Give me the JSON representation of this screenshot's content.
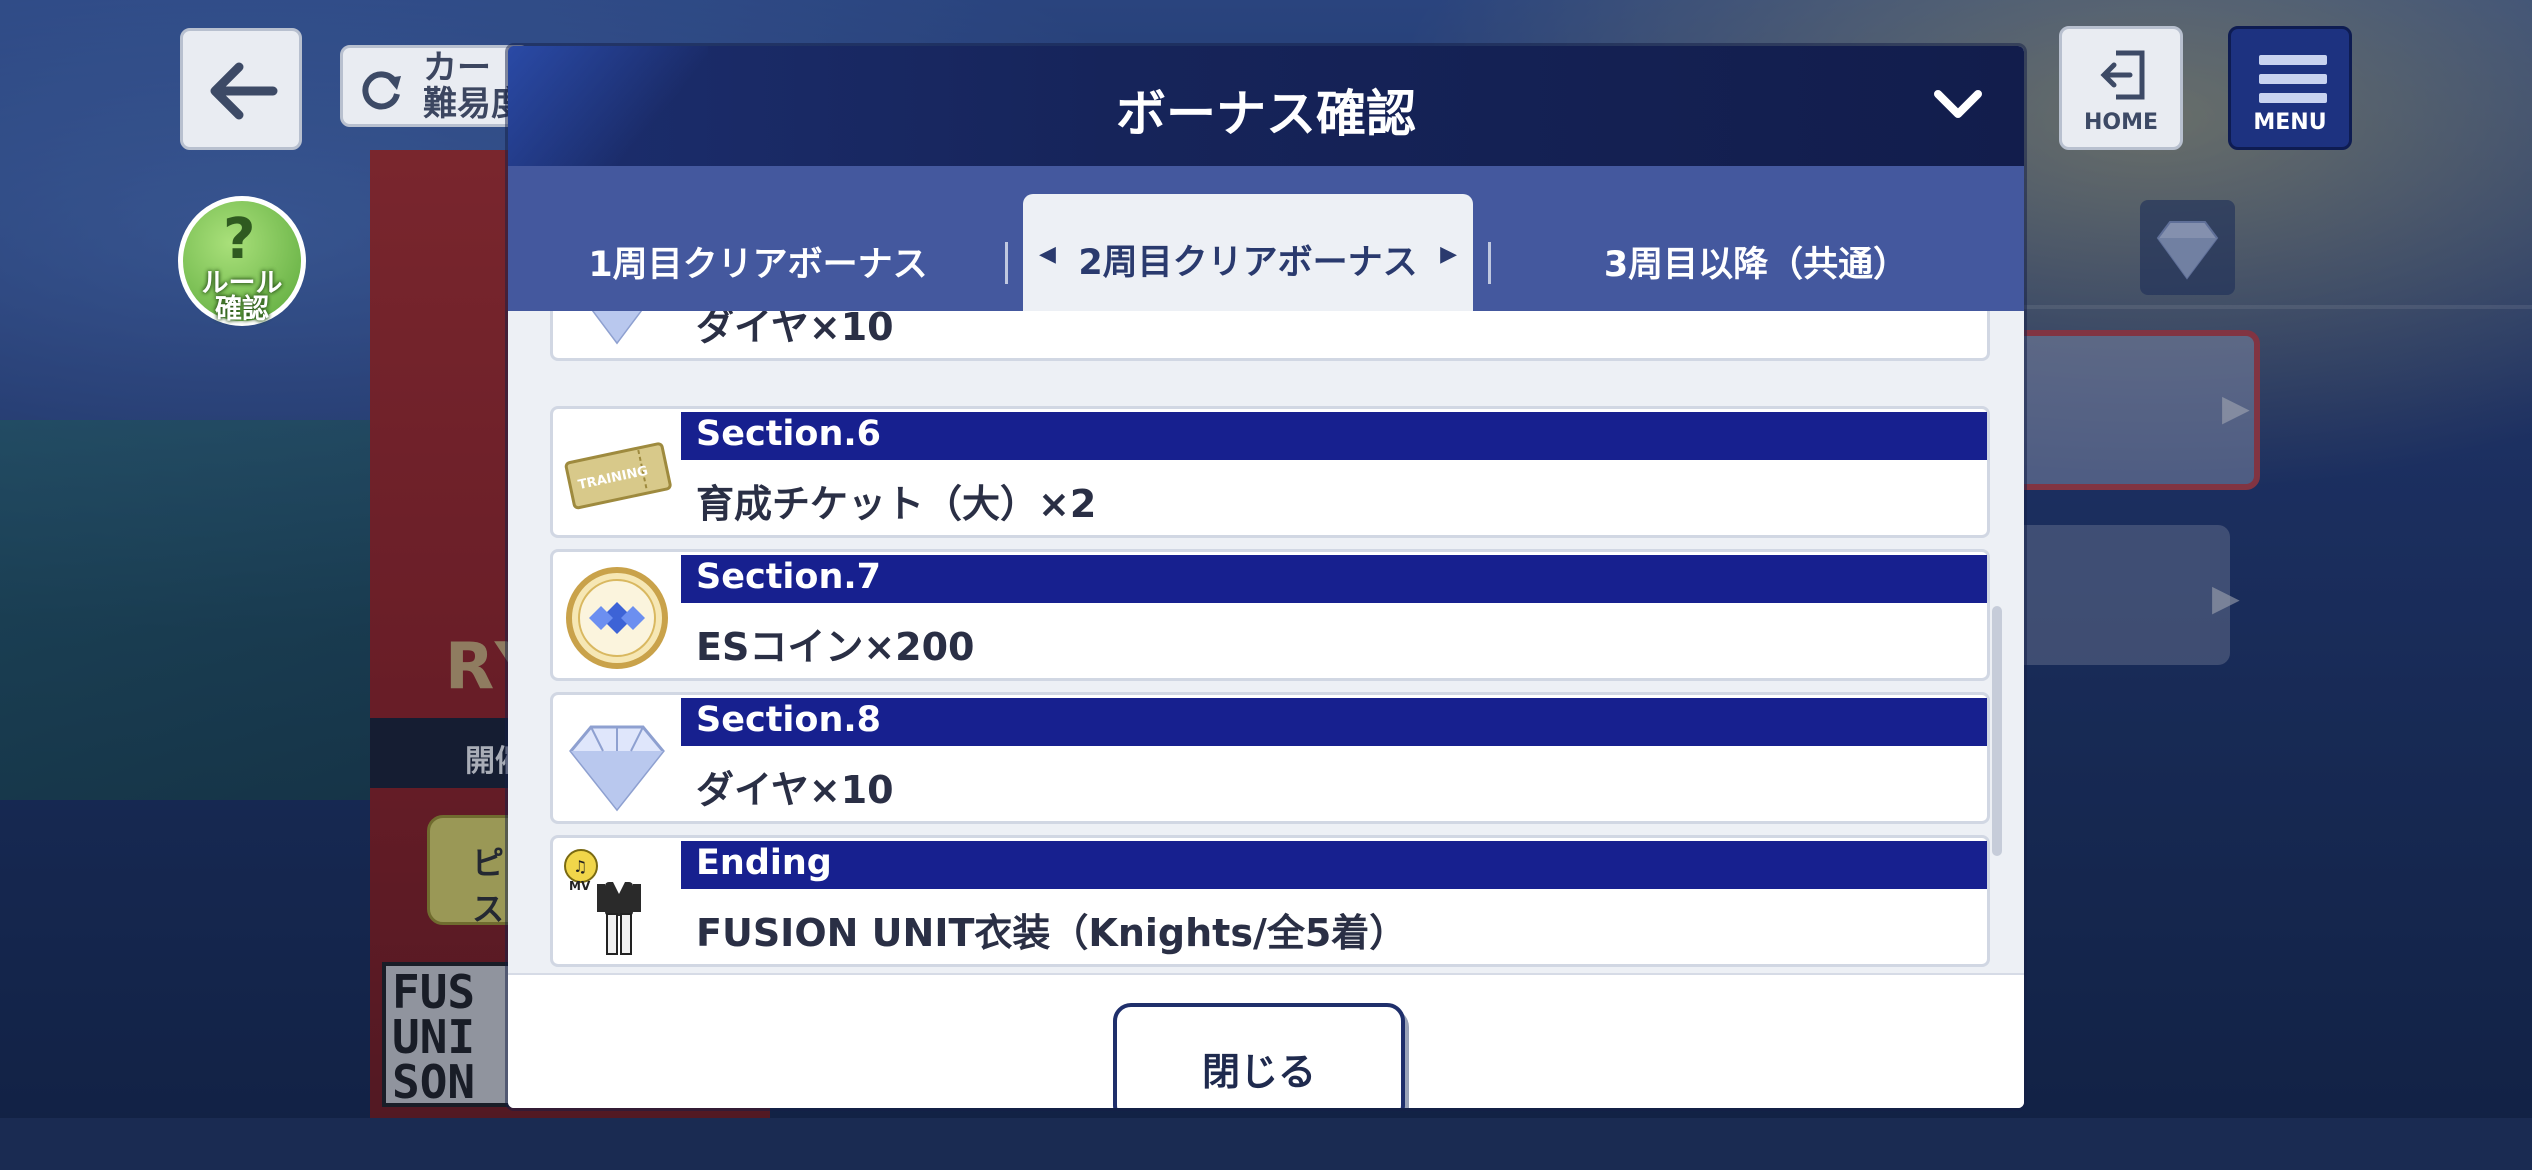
{
  "background": {
    "change_button_label": "カー\n難易度",
    "character_letters": "RY",
    "character_bar_text": "開催",
    "yellow_button_text": "ピ\nス",
    "sonic_text": "FUS\nUNI\nSON"
  },
  "top_bar": {
    "home_label": "HOME",
    "menu_label": "MENU",
    "rule_button_label": "ルール\n確認"
  },
  "modal": {
    "title": "ボーナス確認",
    "tabs": [
      {
        "label": "1周目クリアボーナス",
        "active": false
      },
      {
        "label": "2周目クリアボーナス",
        "active": true
      },
      {
        "label": "3周目以降（共通）",
        "active": false
      }
    ],
    "rows": [
      {
        "section": "",
        "reward": "ダイヤ×10",
        "icon": "diamond-icon"
      },
      {
        "section": "Section.6",
        "reward": "育成チケット（大）×2",
        "icon": "training-ticket-icon"
      },
      {
        "section": "Section.7",
        "reward": "ESコイン×200",
        "icon": "es-coin-icon"
      },
      {
        "section": "Section.8",
        "reward": "ダイヤ×10",
        "icon": "diamond-icon"
      },
      {
        "section": "Ending",
        "reward": "FUSION UNIT衣装（Knights/全5着）",
        "icon": "costume-mv-icon"
      }
    ],
    "close_button_label": "閉じる"
  },
  "colors": {
    "modal_header": "#16245a",
    "tab_bar": "#44589e",
    "section_bar": "#17208f",
    "menu_button": "#1d3280"
  }
}
